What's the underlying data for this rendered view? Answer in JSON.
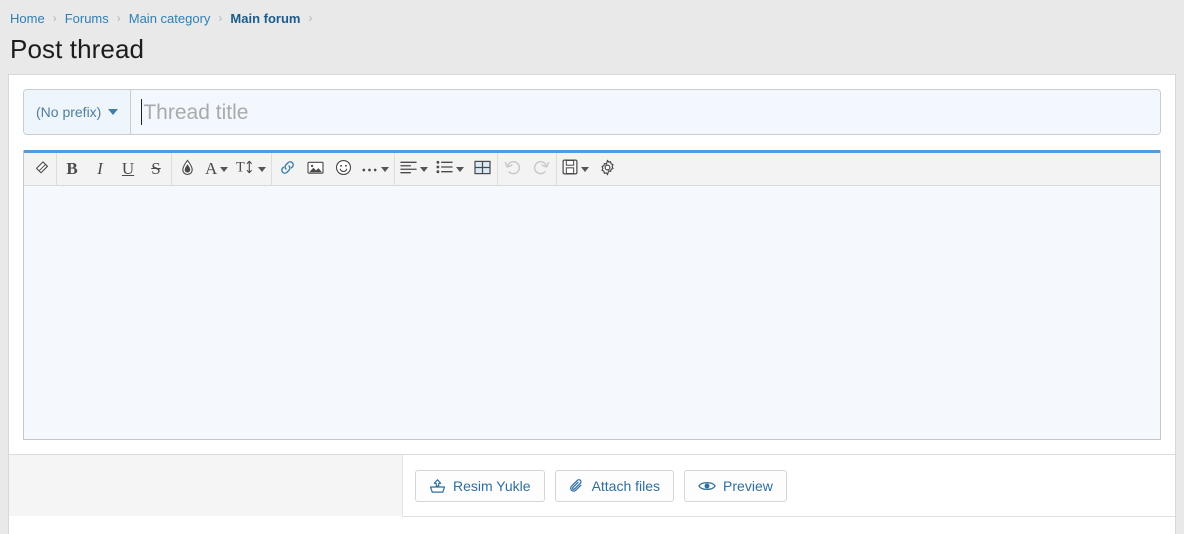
{
  "breadcrumb": {
    "items": [
      {
        "label": "Home",
        "current": false
      },
      {
        "label": "Forums",
        "current": false
      },
      {
        "label": "Main category",
        "current": false
      },
      {
        "label": "Main forum",
        "current": true
      }
    ],
    "separator": "›"
  },
  "page": {
    "title": "Post thread"
  },
  "thread_form": {
    "prefix": {
      "selected_label": "(No prefix)",
      "icon": "chevron-down-icon"
    },
    "title_field": {
      "value": "",
      "placeholder": "Thread title"
    }
  },
  "editor": {
    "content": "",
    "toolbar": {
      "groups": [
        {
          "name": "formatting-remove",
          "buttons": [
            {
              "name": "remove-formatting",
              "icon": "eraser-icon",
              "label": "",
              "caret": false,
              "disabled": false
            }
          ]
        },
        {
          "name": "text-style",
          "buttons": [
            {
              "name": "bold",
              "icon": "bold-icon",
              "label": "B",
              "caret": false,
              "disabled": false
            },
            {
              "name": "italic",
              "icon": "italic-icon",
              "label": "I",
              "caret": false,
              "disabled": false
            },
            {
              "name": "underline",
              "icon": "underline-icon",
              "label": "U",
              "caret": false,
              "disabled": false
            },
            {
              "name": "strikethrough",
              "icon": "strikethrough-icon",
              "label": "S",
              "caret": false,
              "disabled": false
            }
          ]
        },
        {
          "name": "color-font",
          "buttons": [
            {
              "name": "text-highlight",
              "icon": "ink-drop-icon",
              "label": "",
              "caret": false,
              "disabled": false
            },
            {
              "name": "text-color",
              "icon": "font-color-icon",
              "label": "A",
              "caret": true,
              "disabled": false
            },
            {
              "name": "font-size",
              "icon": "font-size-icon",
              "label": "T",
              "caret": true,
              "disabled": false
            }
          ]
        },
        {
          "name": "insert",
          "buttons": [
            {
              "name": "insert-link",
              "icon": "link-icon",
              "label": "",
              "caret": false,
              "disabled": false
            },
            {
              "name": "insert-image",
              "icon": "image-icon",
              "label": "",
              "caret": false,
              "disabled": false
            },
            {
              "name": "insert-smilie",
              "icon": "smiley-icon",
              "label": "",
              "caret": false,
              "disabled": false
            },
            {
              "name": "more-options",
              "icon": "ellipsis-icon",
              "label": "",
              "caret": true,
              "disabled": false
            }
          ]
        },
        {
          "name": "block",
          "buttons": [
            {
              "name": "text-align",
              "icon": "align-left-icon",
              "label": "",
              "caret": true,
              "disabled": false
            },
            {
              "name": "list",
              "icon": "bullet-list-icon",
              "label": "",
              "caret": true,
              "disabled": false
            },
            {
              "name": "insert-table",
              "icon": "table-icon",
              "label": "",
              "caret": false,
              "disabled": false
            }
          ]
        },
        {
          "name": "history",
          "buttons": [
            {
              "name": "undo",
              "icon": "undo-icon",
              "label": "",
              "caret": false,
              "disabled": true
            },
            {
              "name": "redo",
              "icon": "redo-icon",
              "label": "",
              "caret": false,
              "disabled": true
            }
          ]
        },
        {
          "name": "drafts-settings",
          "buttons": [
            {
              "name": "drafts",
              "icon": "floppy-disk-icon",
              "label": "",
              "caret": true,
              "disabled": false
            },
            {
              "name": "editor-settings",
              "icon": "gear-icon",
              "label": "",
              "caret": false,
              "disabled": false
            }
          ]
        }
      ]
    }
  },
  "actions": {
    "buttons": [
      {
        "name": "upload-image-button",
        "label": "Resim Yukle",
        "icon": "upload-icon"
      },
      {
        "name": "attach-files-button",
        "label": "Attach files",
        "icon": "paperclip-icon"
      },
      {
        "name": "preview-button",
        "label": "Preview",
        "icon": "eye-icon"
      }
    ]
  },
  "colors": {
    "accent": "#4e9de0",
    "link": "#2f7fb5",
    "page_background": "#e9e9e9",
    "editor_background": "#f5f9fd"
  }
}
